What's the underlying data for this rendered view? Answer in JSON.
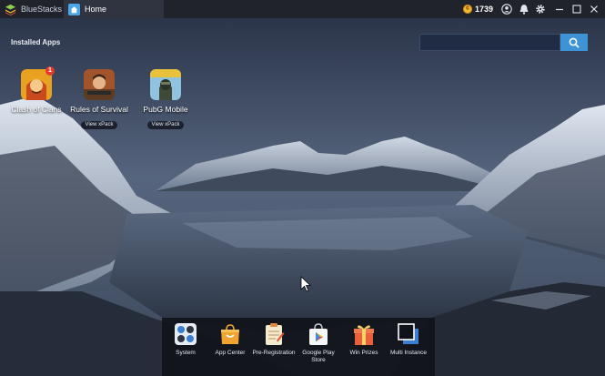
{
  "titlebar": {
    "app_name": "BlueStacks",
    "tab_label": "Home",
    "coins": "1739",
    "icons": [
      "bluestacks-logo-icon",
      "home-icon",
      "coin-icon",
      "profile-icon",
      "bell-icon",
      "gear-icon",
      "minimize-icon",
      "maximize-icon",
      "close-icon"
    ]
  },
  "desktop": {
    "section_title": "Installed Apps",
    "search": {
      "placeholder": ""
    },
    "apps": [
      {
        "label": "Clash of Clans",
        "badge": "1",
        "xpack": ""
      },
      {
        "label": "Rules of Survival",
        "xpack": "View xPack"
      },
      {
        "label": "PubG Mobile",
        "xpack": "View xPack"
      }
    ]
  },
  "dock": {
    "items": [
      {
        "label": "System",
        "icon": "system-apps-icon"
      },
      {
        "label": "App Center",
        "icon": "shopping-bag-icon"
      },
      {
        "label": "Pre-Registration",
        "icon": "clipboard-icon"
      },
      {
        "label": "Google Play Store",
        "icon": "play-store-icon"
      },
      {
        "label": "Win Prizes",
        "icon": "gift-icon"
      },
      {
        "label": "Multi Instance",
        "icon": "multi-instance-icon"
      }
    ]
  },
  "colors": {
    "titlebar_bg": "#20232c",
    "accent": "#3d93d6",
    "coin": "#f2b632",
    "dock_bg": "#11131a"
  }
}
